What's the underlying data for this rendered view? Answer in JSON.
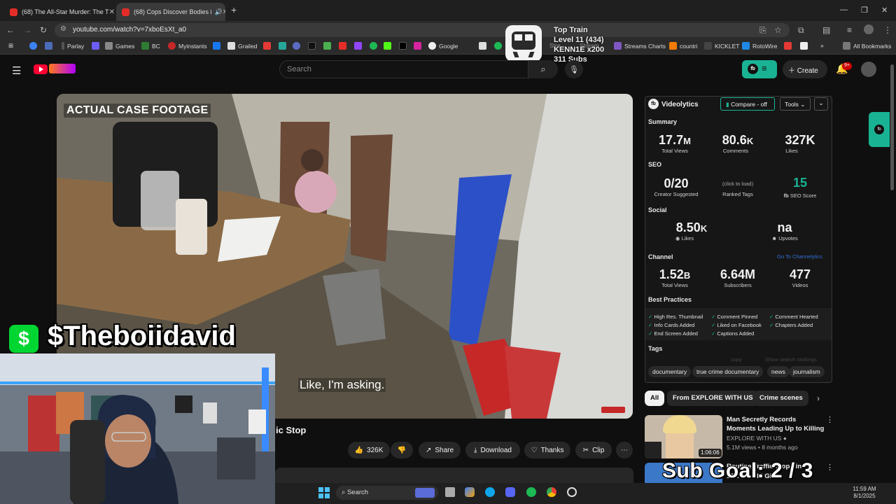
{
  "tabs": [
    {
      "title": "(68) The All-Star Murder: The T"
    },
    {
      "title": "(68) Cops Discover Bodies i"
    }
  ],
  "url": "youtube.com/watch?v=7xboEsXt_a0",
  "bookmarks": [
    "Parlay",
    "Games",
    "BC",
    "Myinstants",
    "Grailed",
    "Google",
    "Streams Charts",
    "countri",
    "KICKLET",
    "RotoWire",
    "All Bookmarks"
  ],
  "bookmarks_partial": [
    "S",
    "Stre",
    "Stream"
  ],
  "train": {
    "title": "Top Train",
    "level": "Level 11  (434)",
    "user": "KENN1E x200",
    "subs": "311 Subs"
  },
  "yt": {
    "search_placeholder": "Search",
    "create_label": "Create",
    "notif_count": "9+"
  },
  "video": {
    "overlay_label": "ACTUAL CASE FOOTAGE",
    "subtitle": "Like, I'm asking.",
    "title_fragment": "ic Stop",
    "watermark": "$Theboiidavid"
  },
  "actions": {
    "likes": "326K",
    "share": "Share",
    "download": "Download",
    "thanks": "Thanks",
    "clip": "Clip"
  },
  "videolytics": {
    "title": "Videolytics",
    "compare": "Compare - off",
    "tools": "Tools",
    "summary_h": "Summary",
    "summary": [
      {
        "v": "17.7",
        "u": "M",
        "l": "Total Views"
      },
      {
        "v": "80.6",
        "u": "K",
        "l": "Comments"
      },
      {
        "v": "327K",
        "u": "",
        "l": "Likes"
      }
    ],
    "seo_h": "SEO",
    "seo": {
      "creator_v": "0/20",
      "creator_l": "Creator Suggested",
      "ranked_v": "(click to load)",
      "ranked_l": "Ranked Tags",
      "score_v": "15",
      "score_l": "SEO Score"
    },
    "social_h": "Social",
    "social": {
      "likes_v": "8.50",
      "likes_u": "K",
      "likes_l": "Likes",
      "upvotes_v": "na",
      "upvotes_l": "Upvotes"
    },
    "channel_h": "Channel",
    "channel_link": "Go To Channelytics",
    "channel": [
      {
        "v": "1.52",
        "u": "B",
        "l": "Total Views"
      },
      {
        "v": "6.64M",
        "u": "",
        "l": "Subscribers"
      },
      {
        "v": "477",
        "u": "",
        "l": "Videos"
      }
    ],
    "bp_h": "Best Practices",
    "bp": [
      "High Res. Thumbnail",
      "Comment Pinned",
      "Comment Hearted",
      "Info Cards Added",
      "Liked on Facebook",
      "Chapters Added",
      "End Screen Added",
      "Captions Added"
    ],
    "tags_h": "Tags",
    "tags_faint": [
      "copy",
      "Show search rankings"
    ],
    "tags": [
      "documentary",
      "true crime documentary",
      "news",
      "journalism"
    ]
  },
  "chips": [
    "All",
    "From EXPLORE WITH US",
    "Crime scenes"
  ],
  "rec": [
    {
      "title": "Man Secretly Records Moments Leading Up to Killing",
      "channel": "EXPLORE WITH US",
      "meta": "5.1M views • 8 months ago",
      "duration": "1:06:06"
    },
    {
      "title": "Routine Traffic Stop Fin",
      "channel": "13 Year Old Gi"
    }
  ],
  "overlay": {
    "sub_goal": "Sub Goal: 2 / 3"
  },
  "taskbar": {
    "search": "Search",
    "time": "11:59 AM",
    "date": "8/1/2025"
  }
}
